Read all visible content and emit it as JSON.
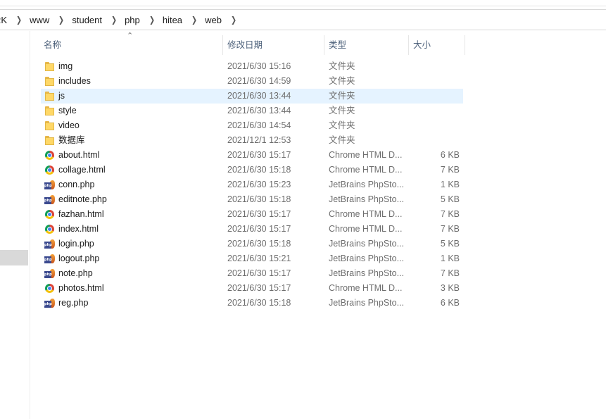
{
  "breadcrumb": [
    "RK",
    "www",
    "student",
    "php",
    "hitea",
    "web"
  ],
  "columns": {
    "name": "名称",
    "date": "修改日期",
    "type": "类型",
    "size": "大小"
  },
  "files": [
    {
      "name": "img",
      "date": "2021/6/30 15:16",
      "type": "文件夹",
      "size": "",
      "icon": "folder-icon"
    },
    {
      "name": "includes",
      "date": "2021/6/30 14:59",
      "type": "文件夹",
      "size": "",
      "icon": "folder-icon"
    },
    {
      "name": "js",
      "date": "2021/6/30 13:44",
      "type": "文件夹",
      "size": "",
      "icon": "folder-icon"
    },
    {
      "name": "style",
      "date": "2021/6/30 13:44",
      "type": "文件夹",
      "size": "",
      "icon": "folder-icon"
    },
    {
      "name": "video",
      "date": "2021/6/30 14:54",
      "type": "文件夹",
      "size": "",
      "icon": "folder-icon"
    },
    {
      "name": "数据库",
      "date": "2021/12/1 12:53",
      "type": "文件夹",
      "size": "",
      "icon": "folder-icon"
    },
    {
      "name": "about.html",
      "date": "2021/6/30 15:17",
      "type": "Chrome HTML D...",
      "size": "6 KB",
      "icon": "chrome-icon"
    },
    {
      "name": "collage.html",
      "date": "2021/6/30 15:18",
      "type": "Chrome HTML D...",
      "size": "7 KB",
      "icon": "chrome-icon"
    },
    {
      "name": "conn.php",
      "date": "2021/6/30 15:23",
      "type": "JetBrains PhpSto...",
      "size": "1 KB",
      "icon": "php-icon"
    },
    {
      "name": "editnote.php",
      "date": "2021/6/30 15:18",
      "type": "JetBrains PhpSto...",
      "size": "5 KB",
      "icon": "php-icon"
    },
    {
      "name": "fazhan.html",
      "date": "2021/6/30 15:17",
      "type": "Chrome HTML D...",
      "size": "7 KB",
      "icon": "chrome-icon"
    },
    {
      "name": "index.html",
      "date": "2021/6/30 15:17",
      "type": "Chrome HTML D...",
      "size": "7 KB",
      "icon": "chrome-icon"
    },
    {
      "name": "login.php",
      "date": "2021/6/30 15:18",
      "type": "JetBrains PhpSto...",
      "size": "5 KB",
      "icon": "php-icon"
    },
    {
      "name": "logout.php",
      "date": "2021/6/30 15:21",
      "type": "JetBrains PhpSto...",
      "size": "1 KB",
      "icon": "php-icon"
    },
    {
      "name": "note.php",
      "date": "2021/6/30 15:17",
      "type": "JetBrains PhpSto...",
      "size": "7 KB",
      "icon": "php-icon"
    },
    {
      "name": "photos.html",
      "date": "2021/6/30 15:17",
      "type": "Chrome HTML D...",
      "size": "3 KB",
      "icon": "chrome-icon"
    },
    {
      "name": "reg.php",
      "date": "2021/6/30 15:18",
      "type": "JetBrains PhpSto...",
      "size": "6 KB",
      "icon": "php-icon"
    }
  ],
  "selected_index": 2,
  "colors": {
    "selection": "#e5f3ff",
    "header_text": "#4c607a",
    "folder": "#ffd867"
  }
}
